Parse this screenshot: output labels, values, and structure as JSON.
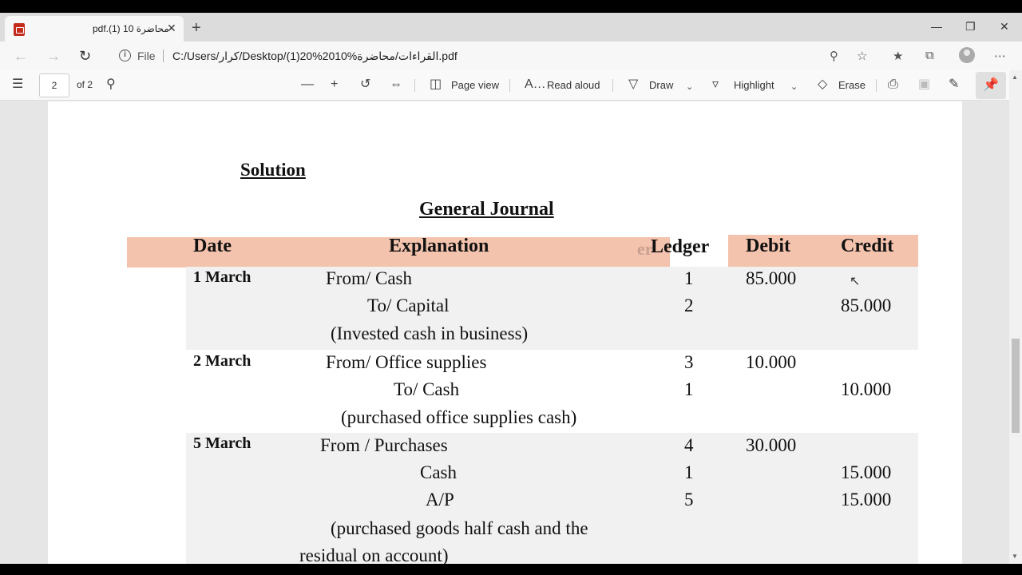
{
  "browser": {
    "tab_title": "pdf.(1) محاضرة 10",
    "tab_close": "✕",
    "new_tab": "+",
    "address": {
      "file_label": "File",
      "url": "C:/Users/کرار/Desktop/(1)20%2010%القراءات/محاضرة.pdf"
    }
  },
  "pdf_toolbar": {
    "page_number": "2",
    "page_total": "of 2",
    "page_view": "Page view",
    "read_aloud": "Read aloud",
    "draw": "Draw",
    "highlight": "Highlight",
    "erase": "Erase"
  },
  "document": {
    "solution_title": "Solution",
    "journal_title": "General Journal",
    "headers": {
      "date": "Date",
      "explanation": "Explanation",
      "ledger": "Ledger",
      "debit": "Debit",
      "credit": "Credit"
    },
    "ghost_text": "er",
    "entries": [
      {
        "date": "1 March",
        "lines": [
          {
            "text": "From/ Cash",
            "ledger": "1",
            "debit": "85.000",
            "credit": ""
          },
          {
            "text": "To/ Capital",
            "ledger": "2",
            "debit": "",
            "credit": "85.000"
          },
          {
            "text": "(Invested cash in business)",
            "ledger": "",
            "debit": "",
            "credit": ""
          }
        ]
      },
      {
        "date": "2 March",
        "lines": [
          {
            "text": "From/ Office supplies",
            "ledger": "3",
            "debit": "10.000",
            "credit": ""
          },
          {
            "text": "To/ Cash",
            "ledger": "1",
            "debit": "",
            "credit": "10.000"
          },
          {
            "text": "(purchased office supplies cash)",
            "ledger": "",
            "debit": "",
            "credit": ""
          }
        ]
      },
      {
        "date": "5 March",
        "lines": [
          {
            "text": "From / Purchases",
            "ledger": "4",
            "debit": "30.000",
            "credit": ""
          },
          {
            "text": "Cash",
            "ledger": "1",
            "debit": "",
            "credit": "15.000"
          },
          {
            "text": "A/P",
            "ledger": "5",
            "debit": "",
            "credit": "15.000"
          },
          {
            "text": "(purchased goods half cash and the",
            "ledger": "",
            "debit": "",
            "credit": ""
          },
          {
            "text": "residual on account)",
            "ledger": "",
            "debit": "",
            "credit": ""
          }
        ]
      }
    ]
  }
}
